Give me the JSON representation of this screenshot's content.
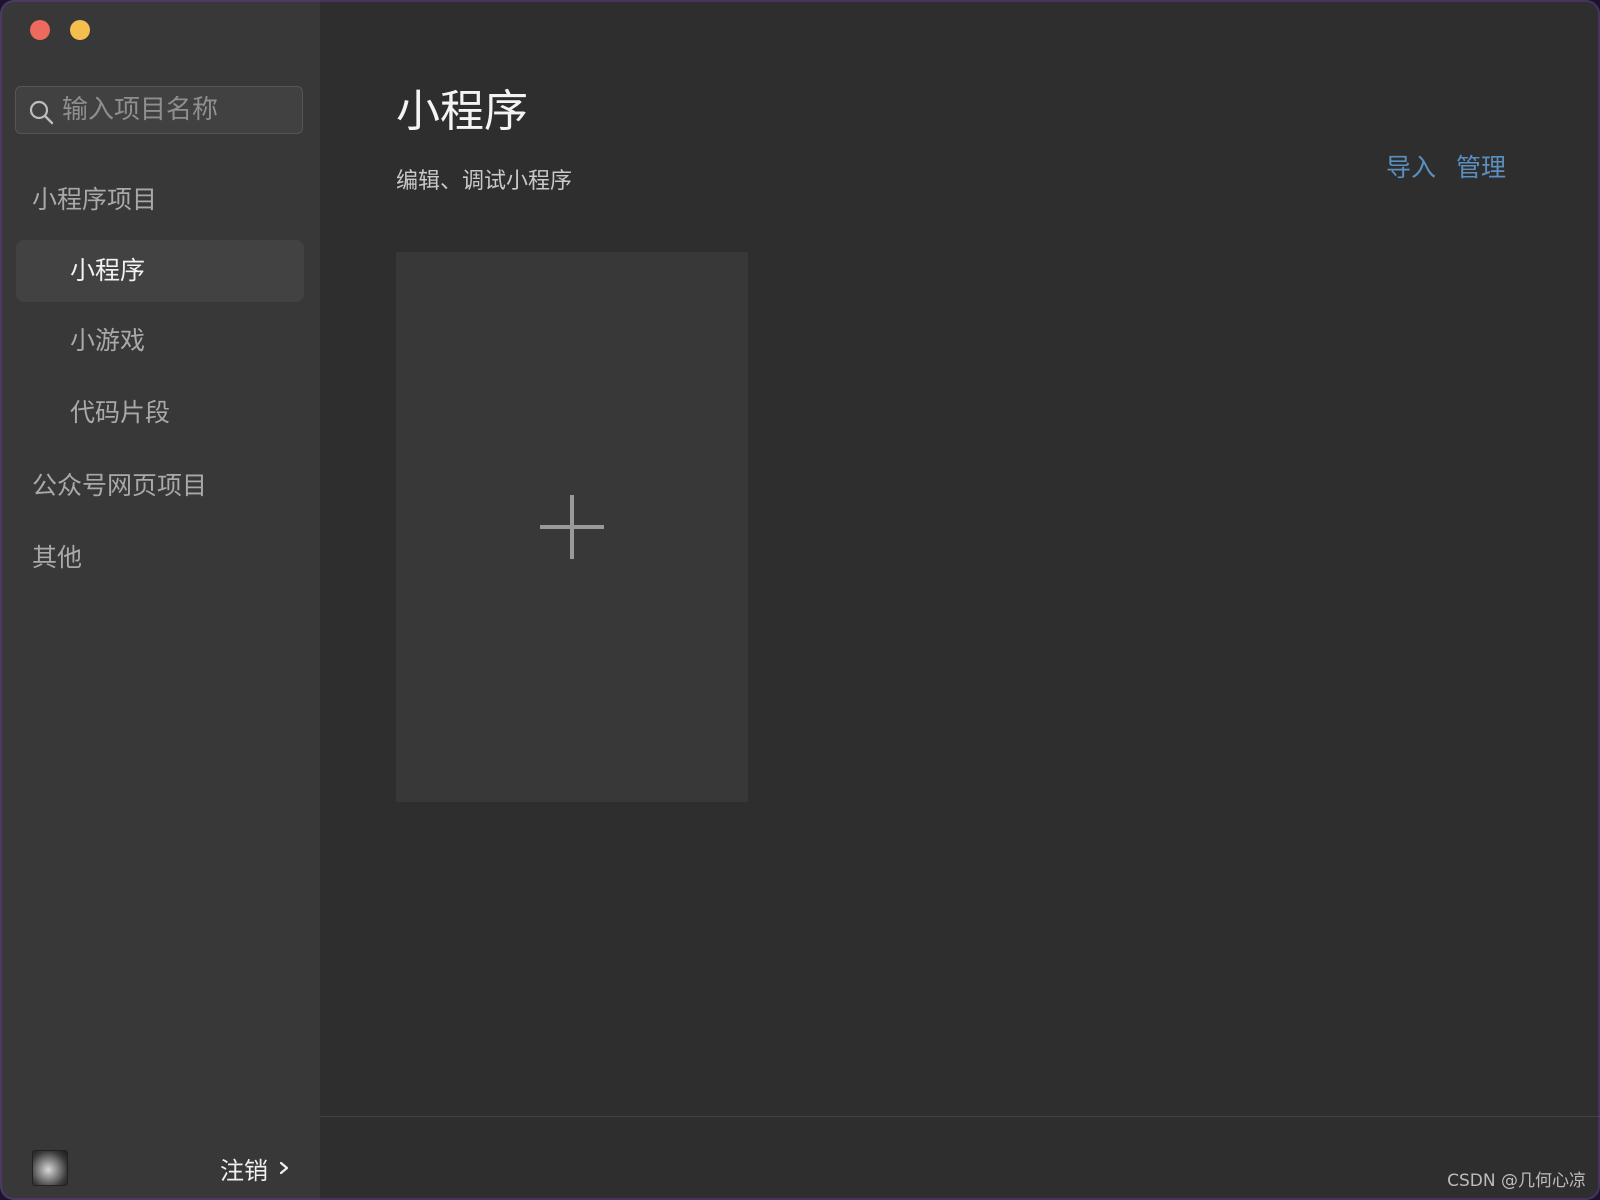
{
  "window": {
    "traffic_lights": [
      "close",
      "minimize"
    ]
  },
  "search": {
    "placeholder": "输入项目名称",
    "value": ""
  },
  "sidebar": {
    "sections": [
      {
        "label": "小程序项目",
        "items": [
          {
            "label": "小程序",
            "active": true
          },
          {
            "label": "小游戏",
            "active": false
          },
          {
            "label": "代码片段",
            "active": false
          }
        ]
      },
      {
        "label": "公众号网页项目"
      },
      {
        "label": "其他"
      }
    ],
    "footer": {
      "logout_label": "注销"
    }
  },
  "main": {
    "title": "小程序",
    "subtitle": "编辑、调试小程序",
    "actions": {
      "import_label": "导入",
      "manage_label": "管理"
    }
  },
  "watermark": "CSDN @几何心凉",
  "colors": {
    "sidebar_bg": "#383838",
    "main_bg": "#2e2e2e",
    "active_item_bg": "#424242",
    "link_color": "#5b8fbf",
    "close_light": "#ec6a5e",
    "minimize_light": "#f4bf4f"
  },
  "icons": {
    "search": "search-icon",
    "plus": "plus-icon",
    "chevron": "chevron-right-icon"
  }
}
